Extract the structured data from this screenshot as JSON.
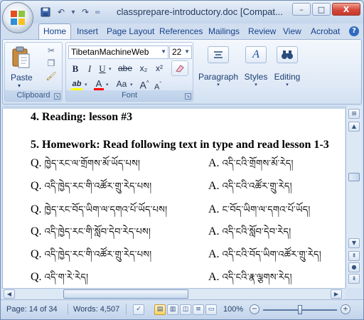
{
  "window": {
    "title": "classprepare-introductory.doc [Compat...",
    "controls": {
      "minimize": "–",
      "maximize": "□",
      "close": "X"
    }
  },
  "qat": {
    "undo": "↶",
    "redo": "↷",
    "dropdown": "="
  },
  "tabs": [
    {
      "label": "Home",
      "active": true
    },
    {
      "label": "Insert"
    },
    {
      "label": "Page Layout"
    },
    {
      "label": "References"
    },
    {
      "label": "Mailings"
    },
    {
      "label": "Review"
    },
    {
      "label": "View"
    },
    {
      "label": "Acrobat"
    }
  ],
  "help_label": "?",
  "ribbon": {
    "clipboard": {
      "label": "Clipboard",
      "paste_label": "Paste"
    },
    "font": {
      "label": "Font",
      "font_name": "TibetanMachineWeb",
      "font_size": "22",
      "bold": "B",
      "italic": "I",
      "underline": "U",
      "strikethrough": "abe",
      "subscript": "x₂",
      "superscript": "x²",
      "highlight": "ab",
      "font_color": "A",
      "change_case": "Aa",
      "grow_font": "A",
      "shrink_font": "A"
    },
    "paragraph": {
      "label": "Paragraph"
    },
    "styles": {
      "label": "Styles"
    },
    "editing": {
      "label": "Editing"
    }
  },
  "document": {
    "heading1": "4. Reading: lesson #3",
    "heading2": "5. Homework: Read following text in type and read lesson 1-3",
    "qa_rows": [
      {
        "q_prefix": "Q.",
        "q_text": "ཁྱེད་རང་ལ་གྲོགས་མོ་ཡོད་པས།",
        "a_prefix": "A.",
        "a_text": "འདི་ངའི་གྲོགས་མོ་རེད།"
      },
      {
        "q_prefix": "Q.",
        "q_text": "འདི་ཁྱེད་རང་གི་འཚོར་གྲུ་རེད་པས།",
        "a_prefix": "A.",
        "a_text": "འདི་ངའི་འཚོར་གྲུ་རེད།"
      },
      {
        "q_prefix": "Q.",
        "q_text": "ཁྱེད་རང་བོད་ཡིག་ལ་དགའ་པོ་ཡོད་པས།",
        "a_prefix": "A.",
        "a_text": "ང་བོད་ཡིག་ལ་དགའ་པོ་ཡོད།"
      },
      {
        "q_prefix": "Q.",
        "q_text": "འདི་ཁྱེད་རང་གི་སློབ་དེབ་རེད་པས།",
        "a_prefix": "A.",
        "a_text": "འདི་ངའི་སློབ་དེབ་རེད།"
      },
      {
        "q_prefix": "Q.",
        "q_text": "འདི་ཁྱེད་རང་གི་འཚོར་གྲུ་རེད་པས།",
        "a_prefix": "A.",
        "a_text": "འདི་ངའི་བོད་ཡིག་འཚོར་གྲུ་རེད།"
      },
      {
        "q_prefix": "Q.",
        "q_text": "འདི་ག་རེ་རེད།",
        "a_prefix": "A.",
        "a_text": "འདི་ངའི་རྣ་ལྕགས་རེད།"
      }
    ]
  },
  "statusbar": {
    "page": "Page: 14 of 34",
    "words": "Words: 4,507",
    "zoom": "100%",
    "zoom_minus": "−",
    "zoom_plus": "+"
  },
  "colors": {
    "highlight": "#ffff00",
    "font_color": "#ff0000",
    "office_logo": [
      "#e44e1f",
      "#8cc63e",
      "#2f8fd7",
      "#f9c11d"
    ]
  }
}
